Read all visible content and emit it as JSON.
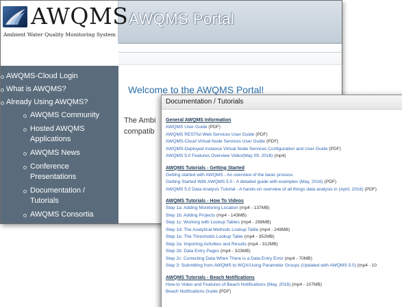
{
  "portal": {
    "logo": {
      "name": "AWQMS",
      "subtitle": "Ambient Water Quality Monitoring System"
    },
    "title": "AWQMS Portal",
    "welcome": "Welcome to the AWQMS Portal!",
    "intro_lines": [
      "The Ambi",
      "compatib"
    ]
  },
  "sidebar": {
    "items": [
      {
        "label": "AWQMS-Cloud Login",
        "level": 1
      },
      {
        "label": "What is AWQMS?",
        "level": 1
      },
      {
        "label": "Already Using AWQMS?",
        "level": 1
      },
      {
        "label": "AWQMS Community",
        "level": 2
      },
      {
        "label": "Hosted AWQMS Applications",
        "level": 2
      },
      {
        "label": "AWQMS News",
        "level": 2
      },
      {
        "label": "Conference Presentations",
        "level": 2
      },
      {
        "label": "Documentation / Tutorials",
        "level": 2
      },
      {
        "label": "AWQMS Consortia",
        "level": 2
      }
    ]
  },
  "docs": {
    "title": "Documentation / Tutorials",
    "sections": [
      {
        "title": "General AWQMS Information",
        "items": [
          {
            "link": "AWQMS User Guide",
            "meta": " (PDF)"
          },
          {
            "link": "AWQMS RESTful Web Services User Guide",
            "meta": " (PDF)"
          },
          {
            "link": "AWQMS-Cloud Virtual Node Services User Guide",
            "meta": " (PDF)"
          },
          {
            "link": "AWQMS-Deployed Instance Virtual Node Services Configuration and User Guide",
            "meta": " (PDF)"
          },
          {
            "link": "AWQMS 5.0 Features Overview Video(May 09, 2016)",
            "meta": " (mp4)"
          }
        ]
      },
      {
        "title": "AWQMS Tutorials - Getting Started",
        "items": [
          {
            "link": "Getting started with AWQMS - An overview of the basic process",
            "meta": ""
          },
          {
            "link": "Getting Started With AWQMS 5.0 - A detailed guide with examples (May, 2016)",
            "meta": " (PDF)"
          },
          {
            "link": "AWQMS 5.0 Data Analysis Tutorial - A hands-on overview of all things data analysis in (April, 2016)",
            "meta": " (PDF)"
          }
        ]
      },
      {
        "title": "AWQMS Tutorials - How To Videos",
        "items": [
          {
            "link": "Step 1a: Adding Monitoring Location",
            "meta": " (mp4 - 137MB)"
          },
          {
            "link": "Step 1b: Adding Projects",
            "meta": " (mp4 - 143MB)"
          },
          {
            "link": "Step 1c: Working with Lookup Tables",
            "meta": " (mp4 - 298MB)"
          },
          {
            "link": "Step 1d: The Analytical Methods Lookup Table",
            "meta": " (mp4 - 249MB)"
          },
          {
            "link": "Step 1e: The Thresholds Lookup Table",
            "meta": " (mp4 - 352MB)"
          },
          {
            "link": "Step 2a: Importing Activities and Results",
            "meta": " (mp4 - 312MB)"
          },
          {
            "link": "Step 2b: Data Entry Pages",
            "meta": " (mp4 - 323MB)"
          },
          {
            "link": "Step 2c: Correcting Data When There is a Data Entry Error",
            "meta": " (mp4 - 70MB)"
          },
          {
            "link": "Step 3: Submitting from AWQMS to WQX/Using Parameter Groups (Updated with AWQMS 5.0)",
            "meta": " (mp4 - 10"
          }
        ]
      },
      {
        "title": "AWQMS Tutorials - Beach Notifications",
        "items": [
          {
            "link": "How-to Video and Features of Beach Notifications (May, 2016)",
            "meta": " (mp4 - 107MB)"
          },
          {
            "link": "Beach Notifications Guide",
            "meta": " (PDF)"
          }
        ]
      }
    ]
  },
  "colors": {
    "sidebar_bg": "#5a6c7c",
    "link": "#2f64b3",
    "welcome": "#2a6ea9",
    "section_title": "#1f3a56"
  }
}
